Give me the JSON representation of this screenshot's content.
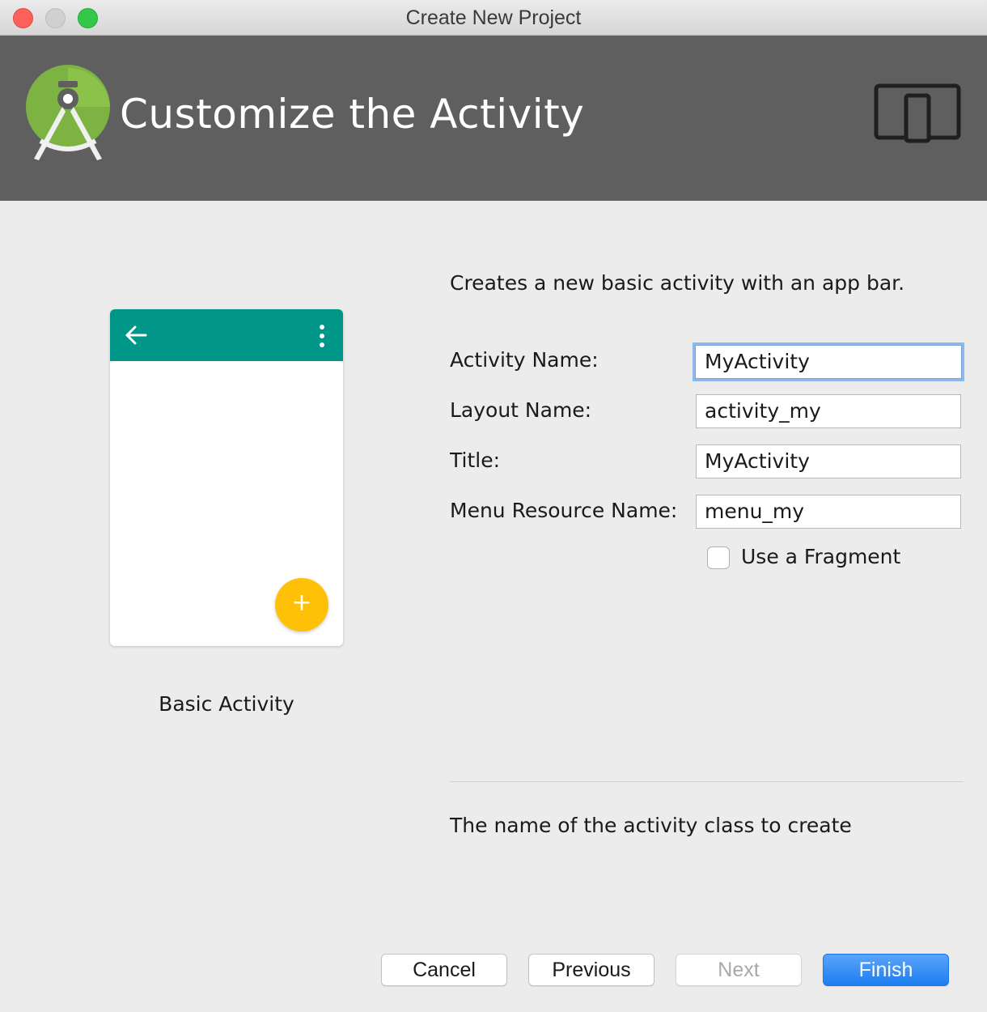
{
  "window": {
    "title": "Create New Project"
  },
  "header": {
    "heading": "Customize the Activity",
    "logo_icon": "android-studio-icon",
    "device_icon": "tablet-phone-icon"
  },
  "preview": {
    "caption": "Basic Activity",
    "appbar_color": "#009688",
    "fab_color": "#ffc107",
    "fab_symbol": "+"
  },
  "form": {
    "description": "Creates a new basic activity with an app bar.",
    "fields": [
      {
        "label": "Activity Name:",
        "value": "MyActivity"
      },
      {
        "label": "Layout Name:",
        "value": "activity_my"
      },
      {
        "label": "Title:",
        "value": "MyActivity"
      },
      {
        "label": "Menu Resource Name:",
        "value": "menu_my"
      }
    ],
    "fragment_checkbox": {
      "label": "Use a Fragment",
      "checked": false
    },
    "help_text": "The name of the activity class to create"
  },
  "buttons": {
    "cancel": "Cancel",
    "previous": "Previous",
    "next": "Next",
    "finish": "Finish",
    "accent_color": "#1d7ef0"
  }
}
